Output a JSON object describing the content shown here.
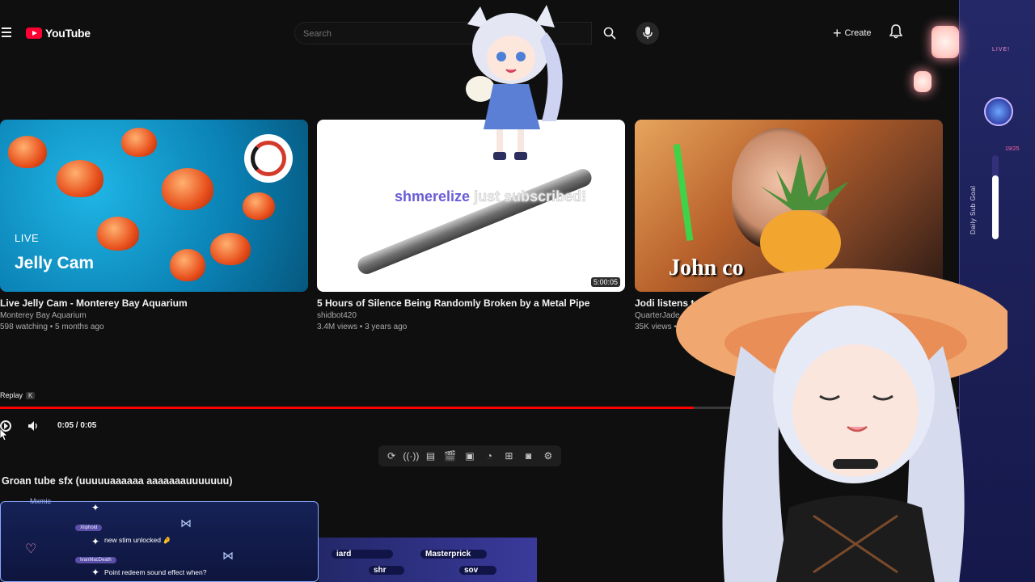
{
  "header": {
    "logo_text": "YouTube",
    "search_placeholder": "Search",
    "create_label": "Create"
  },
  "videos": [
    {
      "title": "Live Jelly Cam - Monterey Bay Aquarium",
      "channel": "Monterey Bay Aquarium",
      "meta": "598 watching • 5 months ago",
      "thumb_live_tag": "LIVE",
      "thumb_text": "Jelly Cam"
    },
    {
      "title": "5 Hours of Silence Being Randomly Broken by a Metal Pipe",
      "channel": "shidbot420",
      "meta": "3.4M views • 3 years ago",
      "duration": "5:00:05"
    },
    {
      "title": "Jodi listens to You'",
      "channel": "QuarterJade Clip",
      "meta": "35K views • 2",
      "thumb_text": "John co"
    }
  ],
  "alert": {
    "name": "shmerelize",
    "text": " just subscribed!"
  },
  "player": {
    "replay_label": "Replay",
    "replay_key": "K",
    "time": "0:05 / 0:05",
    "progress_fraction": 0.67,
    "video_title": "Groan tube sfx (uuuuuaaaaaa aaaaaaauuuuuuu)"
  },
  "tools": [
    "repeat-icon",
    "broadcast-icon",
    "stats-icon",
    "clapper-icon",
    "pip-icon",
    "speed-icon",
    "add-frame-icon",
    "screenshot-icon",
    "gear-icon"
  ],
  "chat": {
    "header": "Mxmic",
    "messages": [
      {
        "user": "Xiiphoid",
        "text": "new stim unlocked 🤌"
      },
      {
        "user": "IvanMacDeath",
        "text": "Point redeem sound effect when?"
      }
    ]
  },
  "stream_bar": {
    "pills": [
      "iard",
      "Masterprick",
      "shr",
      "sov"
    ]
  },
  "goal": {
    "label": "Daily Sub Goal",
    "count": "19/25",
    "fraction": 0.76,
    "live_text": "LIVE!"
  },
  "colors": {
    "brand_red": "#ff0033",
    "accent_purple": "#6a5cd6",
    "overlay_blue": "#232869"
  }
}
